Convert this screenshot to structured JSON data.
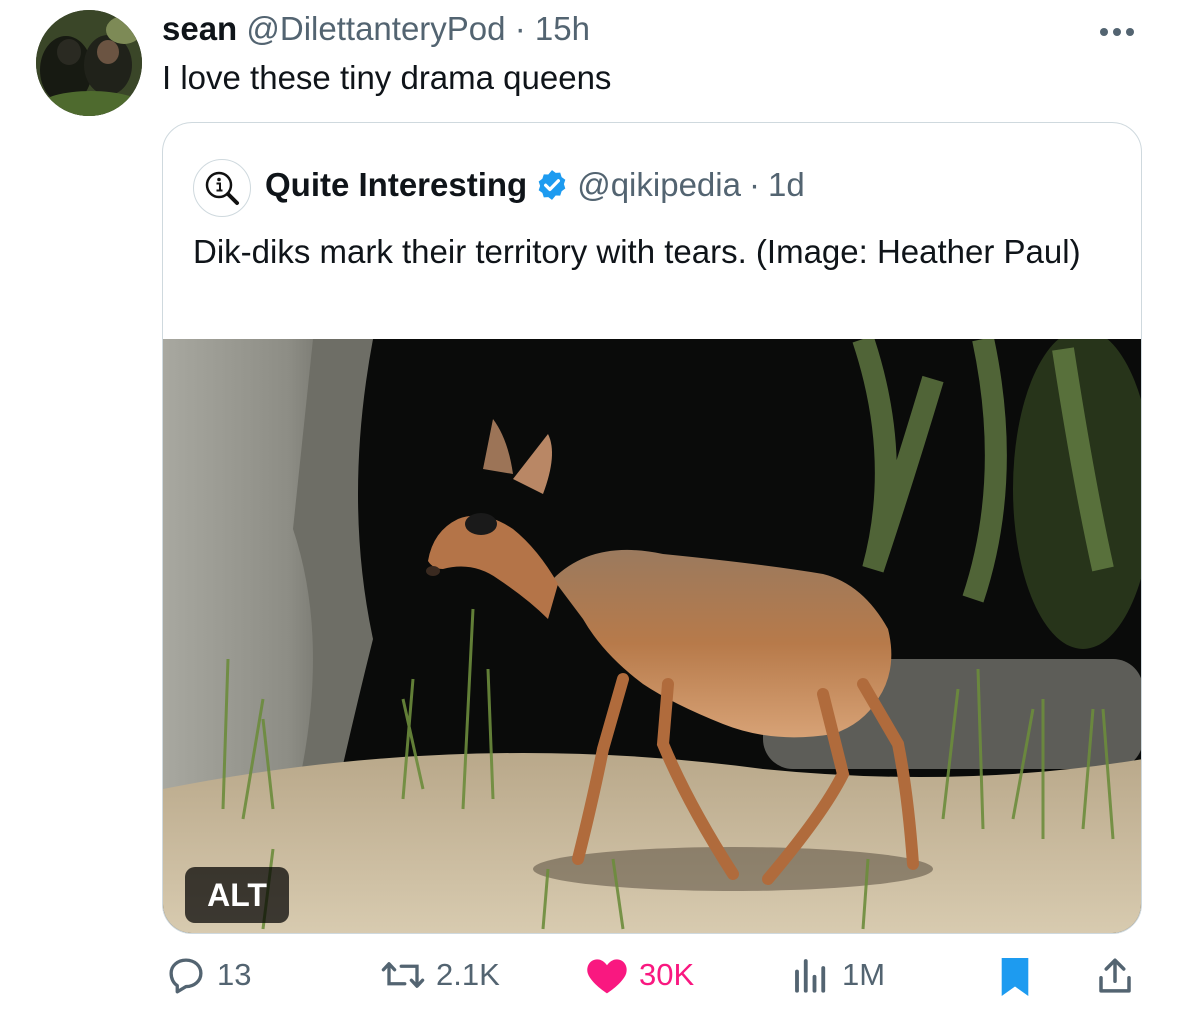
{
  "tweet": {
    "author_name": "sean",
    "author_handle": "@DilettanteryPod",
    "separator": "·",
    "time": "15h",
    "text": "I love these tiny drama queens"
  },
  "quote": {
    "author_name": "Quite Interesting",
    "author_handle": "@qikipedia",
    "separator": "·",
    "time": "1d",
    "text": "Dik-diks mark their territory with tears. (Image: Heather Paul)",
    "alt_label": "ALT",
    "verified": true,
    "avatar_icon": "magnifier-info-icon"
  },
  "actions": {
    "replies": "13",
    "reposts": "2.1K",
    "likes": "30K",
    "views": "1M"
  },
  "colors": {
    "secondary_text": "#536471",
    "like_pink": "#f91880",
    "bookmark_blue": "#1d9bf0",
    "border": "#cfd9de"
  }
}
